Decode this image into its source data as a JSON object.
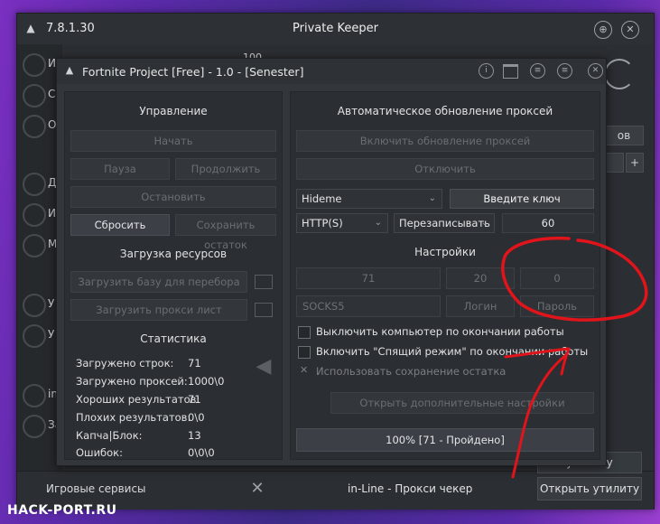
{
  "outer_window": {
    "version": "7.8.1.30",
    "title": "Private Keeper",
    "side_letters": [
      "И",
      "С",
      "О",
      "Д",
      "И",
      "М",
      "У",
      "У",
      "in",
      "За"
    ],
    "side_number": "100",
    "right_stub_label": "ов",
    "right_stub_plus": "+",
    "bottom": {
      "games_label": "Игровые сервисы",
      "center_label": "in-Line - Прокси чекер",
      "open_utility": "Открыть утилиту",
      "open_utility_partial": "утилиту"
    }
  },
  "dialog": {
    "title": "Fortnite Project [Free] - 1.0 - [Senester]",
    "management": {
      "title": "Управление",
      "start": "Начать",
      "pause": "Пауза",
      "resume": "Продолжить",
      "stop": "Остановить",
      "reset": "Сбросить",
      "save_rest": "Сохранить остаток"
    },
    "resources": {
      "title": "Загрузка ресурсов",
      "load_base": "Загрузить базу для перебора",
      "load_proxy": "Загрузить прокси лист"
    },
    "stats": {
      "title": "Статистика",
      "rows": [
        {
          "k": "Загружено строк:",
          "v": "71"
        },
        {
          "k": "Загружено проксей:",
          "v": "1000\\0"
        },
        {
          "k": "Хороших результатов:",
          "v": "71"
        },
        {
          "k": "Плохих результатов:",
          "v": "0\\0"
        },
        {
          "k": "Капча|Блок:",
          "v": "13"
        },
        {
          "k": "Ошибок:",
          "v": "0\\0\\0"
        }
      ]
    },
    "proxy_update": {
      "title": "Автоматическое обновление проксей",
      "enable": "Включить обновление проксей",
      "disable": "Отключить",
      "provider": "Hideme",
      "enter_key": "Введите ключ",
      "protocol": "HTTP(S)",
      "mode": "Перезаписывать",
      "interval": "60"
    },
    "settings": {
      "title": "Настройки",
      "threads": "71",
      "timeout": "20",
      "retries": "0",
      "proxy_type": "SOCKS5",
      "login": "Логин",
      "password": "Пароль",
      "opt_shutdown": "Выключить компьютер по окончании работы",
      "opt_sleep": "Включить \"Спящий режим\" по окончании работы",
      "opt_save_rest": "Использовать сохранение остатка",
      "more_settings": "Открыть дополнительные настройки"
    },
    "progress": "100% [71 - Пройдено]"
  },
  "watermark": "HACK-PORT.RU",
  "colors": {
    "window_bg": "#2b2e32",
    "dialog_bg": "#33363a",
    "annotation": "#e0141a"
  }
}
